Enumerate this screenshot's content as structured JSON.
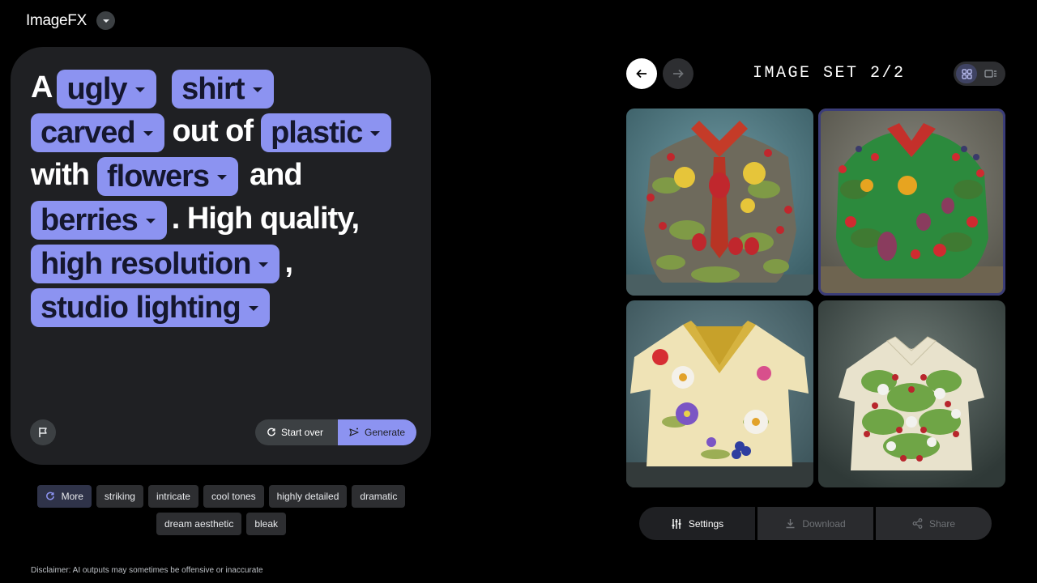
{
  "app": {
    "title": "ImageFX"
  },
  "prompt": {
    "line1": {
      "w1": "A",
      "c1": "ugly",
      "c2": "shirt"
    },
    "line2": {
      "c1": "carved",
      "w1": "out of",
      "c2": "plastic"
    },
    "line3": {
      "w1": "with",
      "c1": "flowers",
      "w2": "and"
    },
    "line4": {
      "c1": "berries",
      "w1": ". High quality,"
    },
    "line5": {
      "c1": "high resolution",
      "w1": ","
    },
    "line6": {
      "c1": "studio lighting"
    }
  },
  "actions": {
    "start_over": "Start over",
    "generate": "Generate"
  },
  "suggestions": {
    "more": "More",
    "items": [
      "striking",
      "intricate",
      "cool tones",
      "highly detailed",
      "dramatic",
      "dream aesthetic",
      "bleak"
    ]
  },
  "disclaimer": "Disclaimer: AI outputs may sometimes be offensive or inaccurate",
  "gallery": {
    "set_title": "IMAGE SET 2/2"
  },
  "bottom": {
    "settings": "Settings",
    "download": "Download",
    "share": "Share"
  },
  "colors": {
    "accent": "#8c93f1",
    "card": "#1f2023",
    "background": "#000000"
  }
}
